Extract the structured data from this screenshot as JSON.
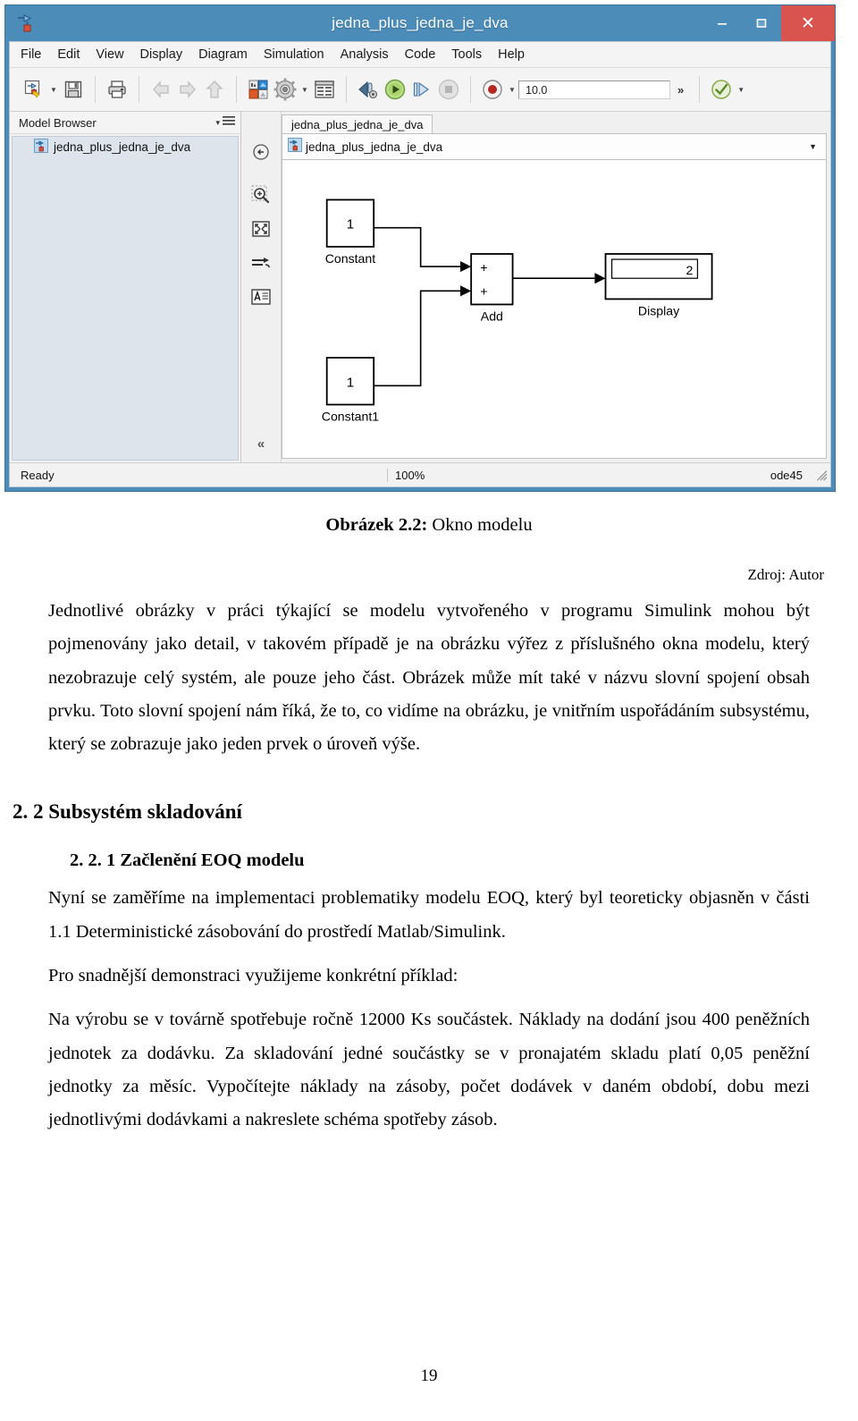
{
  "window": {
    "title": "jedna_plus_jedna_je_dva",
    "icon": "simulink-model-icon",
    "minimize_label": "–",
    "maximize_label": "❑",
    "close_label": "✕",
    "close_color": "#d9534f",
    "titlebar_color": "#4b8cb8"
  },
  "menubar": {
    "items": [
      {
        "label": "File"
      },
      {
        "label": "Edit"
      },
      {
        "label": "View"
      },
      {
        "label": "Display"
      },
      {
        "label": "Diagram"
      },
      {
        "label": "Simulation"
      },
      {
        "label": "Analysis"
      },
      {
        "label": "Code"
      },
      {
        "label": "Tools"
      },
      {
        "label": "Help"
      }
    ]
  },
  "toolbar": {
    "new_model": "new-model-icon",
    "new_model_caret": "▼",
    "save": "save-icon",
    "print": "print-icon",
    "back": "back-arrow-icon",
    "forward": "forward-arrow-icon",
    "up": "up-arrow-icon",
    "library_browser": "library-browser-icon",
    "model_settings": "gear-icon",
    "model_settings_caret": "▼",
    "model_explorer": "model-explorer-icon",
    "update_diagram": "update-diagram-icon",
    "run": "run-icon",
    "step_forward": "step-forward-icon",
    "stop": "stop-icon",
    "record": "record-icon",
    "record_caret": "▼",
    "sim_time_value": "10.0",
    "overflow": "»",
    "check_model": "check-model-icon",
    "check_model_caret": "▼"
  },
  "model_browser": {
    "title": "Model Browser",
    "options_caret": "▾",
    "options_menu": "list-menu-icon",
    "tree": [
      {
        "label": "jedna_plus_jedna_je_dva",
        "icon": "simulink-model-icon"
      }
    ]
  },
  "canvas_tools": {
    "back_to_parent": "back-circle-icon",
    "zoom_in": "zoom-in-icon",
    "fit_to_view": "fit-to-view-icon",
    "signal_arrow": "signal-arrow-icon",
    "annotation": "annotation-icon",
    "collapse": "«"
  },
  "editor": {
    "tab_label": "jedna_plus_jedna_je_dva",
    "breadcrumb": "jedna_plus_jedna_je_dva",
    "breadcrumb_icon": "simulink-model-icon",
    "breadcrumb_caret": "▼"
  },
  "diagram": {
    "blocks": [
      {
        "id": "constant",
        "type": "Constant",
        "label": "Constant",
        "value": "1"
      },
      {
        "id": "constant1",
        "type": "Constant",
        "label": "Constant1",
        "value": "1"
      },
      {
        "id": "add",
        "type": "Add",
        "label": "Add",
        "signs": [
          "+",
          "+"
        ]
      },
      {
        "id": "display",
        "type": "Display",
        "label": "Display",
        "value": "2"
      }
    ]
  },
  "statusbar": {
    "status": "Ready",
    "zoom": "100%",
    "solver": "ode45",
    "grip": "resize-grip-icon"
  },
  "document": {
    "figure_caption_bold": "Obrázek 2.2:",
    "figure_caption_rest": " Okno modelu",
    "source": "Zdroj: Autor",
    "paragraph1": "Jednotlivé obrázky v práci týkající se modelu vytvořeného v programu Simulink mohou být pojmenovány jako detail, v takovém případě je na obrázku výřez z příslušného okna modelu, který nezobrazuje celý systém, ale pouze jeho část. Obrázek může mít také v názvu slovní spojení obsah prvku. Toto slovní spojení nám říká, že to, co vidíme na obrázku, je vnitřním uspořádáním subsystému, který se zobrazuje jako jeden prvek o úroveň výše.",
    "heading_h2": "2. 2 Subsystém skladování",
    "heading_h3": "2. 2. 1 Začlenění EOQ modelu",
    "paragraph2": "Nyní se zaměříme na implementaci problematiky modelu EOQ, který byl teoreticky objasněn v části 1.1 Deterministické zásobování do prostředí Matlab/Simulink.",
    "paragraph3": "Pro snadnější demonstraci využijeme konkrétní příklad:",
    "paragraph4": "Na výrobu se v továrně spotřebuje ročně 12000 Ks součástek. Náklady na dodání jsou 400 peněžních jednotek za dodávku. Za skladování jedné součástky se v pronajatém skladu platí 0,05 peněžní jednotky za měsíc. Vypočítejte náklady na zásoby, počet dodávek v daném období, dobu mezi jednotlivými dodávkami a nakreslete schéma spotřeby zásob.",
    "page_number": "19"
  }
}
